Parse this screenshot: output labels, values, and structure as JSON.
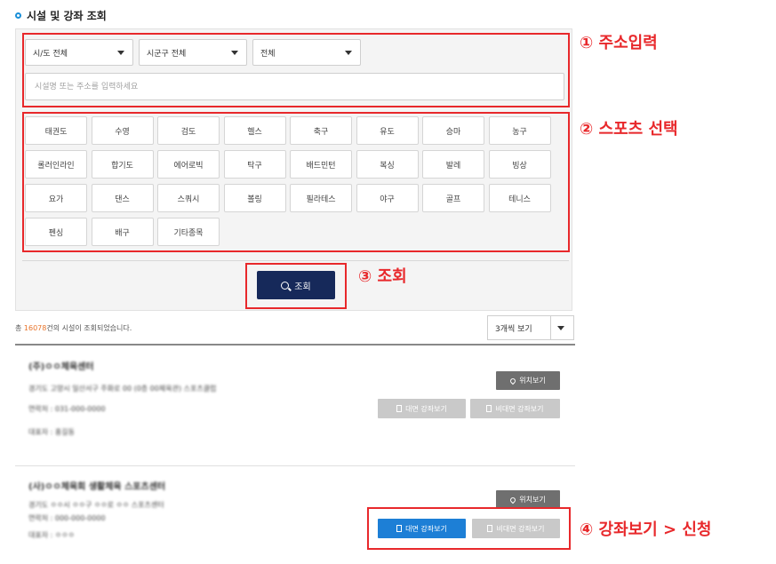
{
  "title": "시설 및 강좌 조회",
  "filters": {
    "region": "시/도 전체",
    "district": "시군구 전체",
    "category": "전체",
    "search_placeholder": "시설명 또는 주소를 입력하세요"
  },
  "sports": [
    "태권도",
    "수영",
    "검도",
    "헬스",
    "축구",
    "유도",
    "승마",
    "농구",
    "롤러인라인",
    "합기도",
    "에어로빅",
    "탁구",
    "배드민턴",
    "복싱",
    "발레",
    "빙상",
    "요가",
    "댄스",
    "스쿼시",
    "볼링",
    "필라테스",
    "야구",
    "골프",
    "테니스",
    "펜싱",
    "배구",
    "기타종목"
  ],
  "search_button": "조회",
  "annotations": {
    "a1": "① 주소입력",
    "a2": "② 스포츠 선택",
    "a3": "③ 조회",
    "a4": "④ 강좌보기 > 신청"
  },
  "results": {
    "prefix": "총 ",
    "count": "16078",
    "suffix": "건의 시설이 조회되었습니다.",
    "view_option": "3개씩 보기"
  },
  "facilities": [
    {
      "name": "(주)ㅇㅇ체육센터",
      "address": "경기도 고양시 일산서구 주화로 00 (0층 00체육관) 스포츠클럽",
      "phone": "연락처 : 031-000-0000",
      "rep": "대표자 : 홍길동"
    },
    {
      "name": "(사)ㅇㅇ체육회 생활체육 스포츠센터",
      "address": "경기도 ㅇㅇ시 ㅇㅇ구 ㅇㅇ로 ㅇㅇ 스포츠센터",
      "phone": "연락처 : 000-000-0000",
      "rep": "대표자 : ㅇㅇㅇ"
    }
  ],
  "buttons": {
    "location": "위치보기",
    "offline": "대면 강좌보기",
    "online": "비대면 강좌보기"
  },
  "colors": {
    "annotation": "#e8282b",
    "primary_button": "#16295a",
    "active_course": "#1d7fd6",
    "count_highlight": "#e8742b"
  }
}
